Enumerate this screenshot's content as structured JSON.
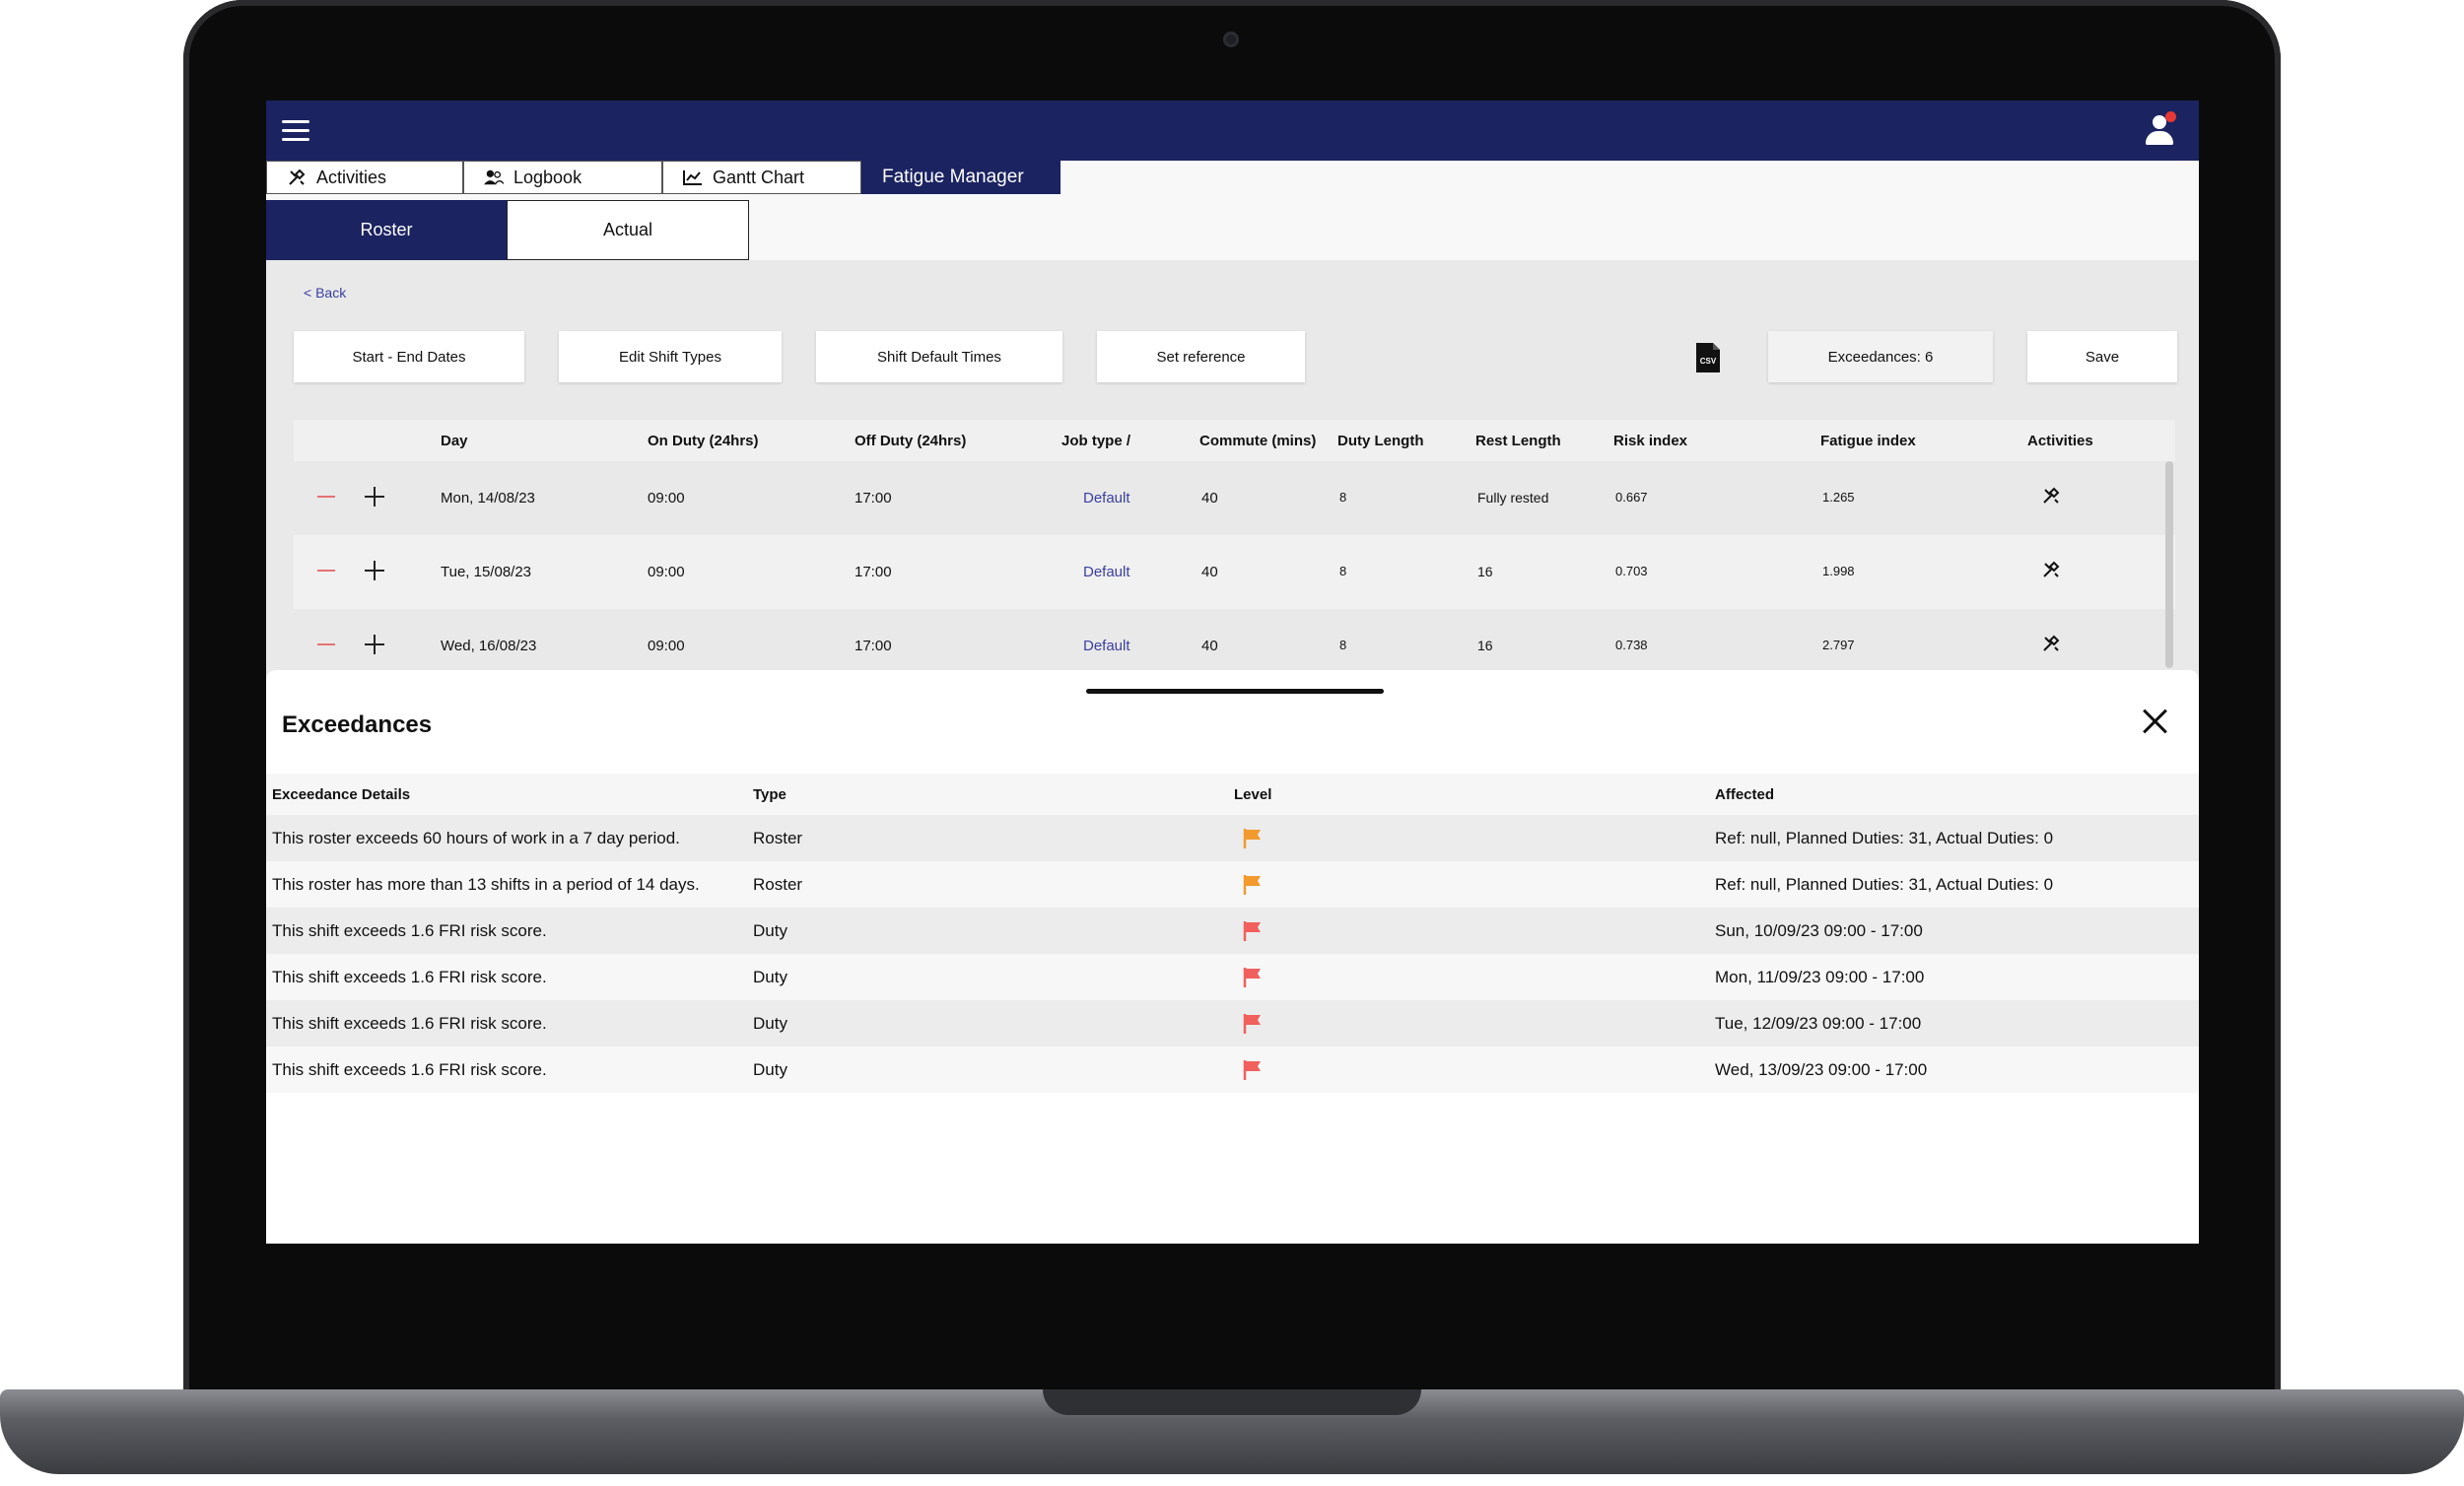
{
  "tabs": [
    {
      "label": "Activities",
      "icon": "tools-icon"
    },
    {
      "label": "Logbook",
      "icon": "users-icon"
    },
    {
      "label": "Gantt Chart",
      "icon": "chart-line-icon"
    },
    {
      "label": "Fatigue Manager",
      "active": true
    }
  ],
  "subtabs": [
    {
      "label": "Roster",
      "active": true
    },
    {
      "label": "Actual"
    }
  ],
  "back_label": "< Back",
  "toolbar": {
    "start_end": "Start - End Dates",
    "edit_shift": "Edit Shift Types",
    "shift_default": "Shift Default Times",
    "set_reference": "Set reference",
    "exceedances": "Exceedances: 6",
    "save": "Save"
  },
  "roster": {
    "columns": [
      "Day",
      "On Duty (24hrs)",
      "Off Duty (24hrs)",
      "Job type /",
      "Commute (mins)",
      "Duty Length",
      "Rest Length",
      "Risk index",
      "Fatigue index",
      "Activities"
    ],
    "rows": [
      {
        "day": "Mon, 14/08/23",
        "on": "09:00",
        "off": "17:00",
        "job": "Default",
        "commute": "40",
        "duty": "8",
        "rest": "Fully rested",
        "risk": "0.667",
        "fatigue": "1.265"
      },
      {
        "day": "Tue, 15/08/23",
        "on": "09:00",
        "off": "17:00",
        "job": "Default",
        "commute": "40",
        "duty": "8",
        "rest": "16",
        "risk": "0.703",
        "fatigue": "1.998"
      },
      {
        "day": "Wed, 16/08/23",
        "on": "09:00",
        "off": "17:00",
        "job": "Default",
        "commute": "40",
        "duty": "8",
        "rest": "16",
        "risk": "0.738",
        "fatigue": "2.797"
      }
    ]
  },
  "exceedances": {
    "title": "Exceedances",
    "columns": [
      "Exceedance Details",
      "Type",
      "Level",
      "Affected"
    ],
    "rows": [
      {
        "details": "This roster exceeds 60 hours of work in a 7 day period.",
        "type": "Roster",
        "level": "orange",
        "affected": "Ref: null, Planned Duties: 31, Actual Duties: 0"
      },
      {
        "details": "This roster has more than 13 shifts in a period of 14 days.",
        "type": "Roster",
        "level": "orange",
        "affected": "Ref: null, Planned Duties: 31, Actual Duties: 0"
      },
      {
        "details": "This shift exceeds 1.6 FRI risk score.",
        "type": "Duty",
        "level": "red",
        "affected": "Sun, 10/09/23 09:00 - 17:00"
      },
      {
        "details": "This shift exceeds 1.6 FRI risk score.",
        "type": "Duty",
        "level": "red",
        "affected": "Mon, 11/09/23 09:00 - 17:00"
      },
      {
        "details": "This shift exceeds 1.6 FRI risk score.",
        "type": "Duty",
        "level": "red",
        "affected": "Tue, 12/09/23 09:00 - 17:00"
      },
      {
        "details": "This shift exceeds 1.6 FRI risk score.",
        "type": "Duty",
        "level": "red",
        "affected": "Wed, 13/09/23 09:00 - 17:00"
      }
    ]
  },
  "colors": {
    "navy": "#1b2361",
    "flag_orange": "#f29a2e",
    "flag_red": "#f0605d",
    "link": "#3a3fa0"
  }
}
